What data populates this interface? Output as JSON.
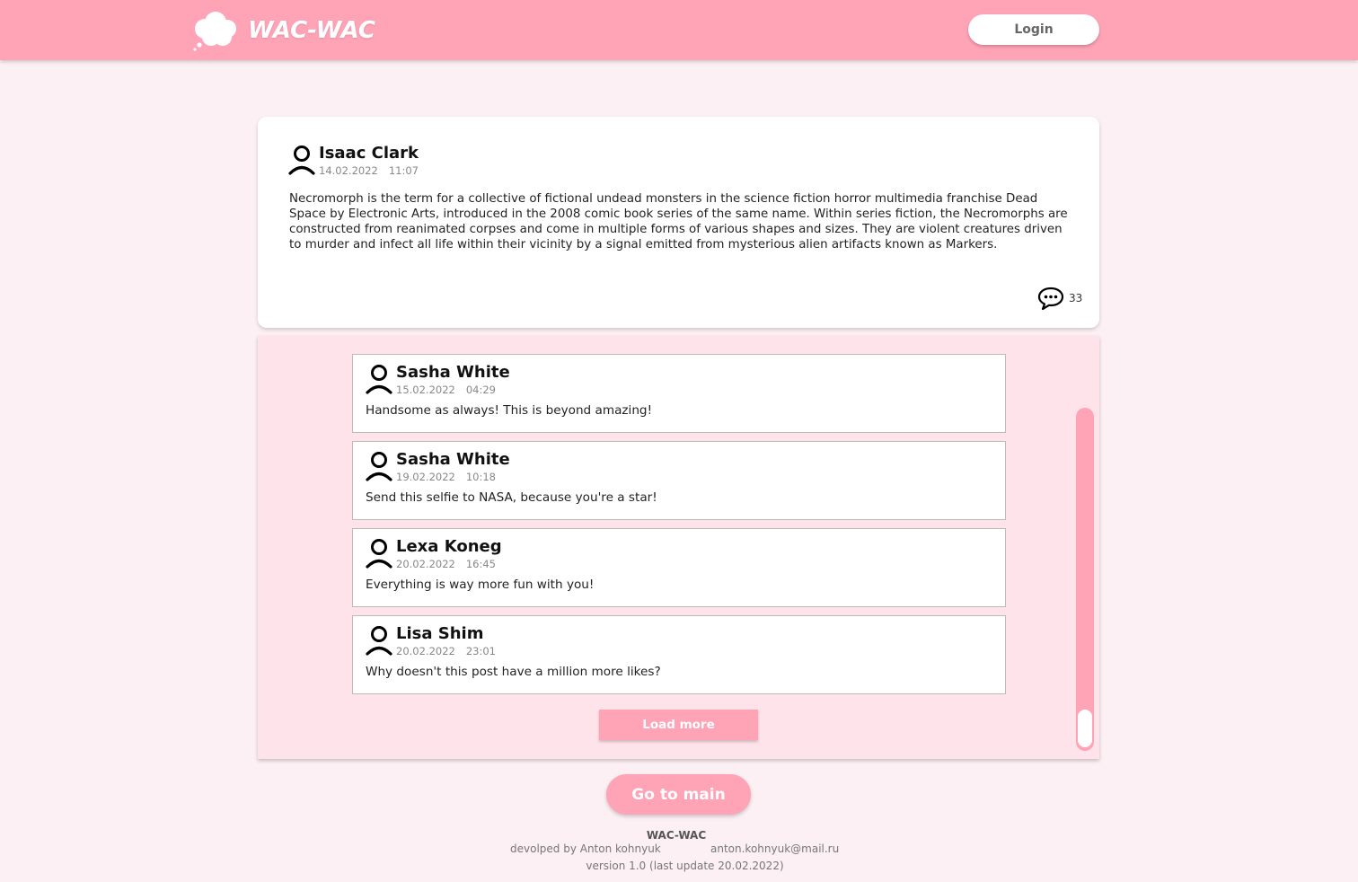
{
  "app": {
    "name": "WAC-WAC"
  },
  "header": {
    "login_label": "Login"
  },
  "post": {
    "author": "Isaac Clark",
    "date": "14.02.2022",
    "time": "11:07",
    "text": "Necromorph is the term for a collective of fictional undead monsters in the science fiction horror multimedia franchise Dead Space by Electronic Arts, introduced in the 2008 comic book series of the same name. Within series fiction, the Necromorphs are constructed from reanimated corpses and come in multiple forms of various shapes and sizes. They are violent creatures driven to murder and infect all life within their vicinity by a signal emitted from mysterious alien artifacts known as Markers.",
    "comment_count": "33",
    "comment_icon": "speech-bubble-icon",
    "author_icon": "user-icon"
  },
  "comments": [
    {
      "author": "Sasha White",
      "date": "15.02.2022",
      "time": "04:29",
      "text": "Handsome as always! This is beyond amazing!"
    },
    {
      "author": "Sasha White",
      "date": "19.02.2022",
      "time": "10:18",
      "text": "Send this selfie to NASA, because you're a star!"
    },
    {
      "author": "Lexa Koneg",
      "date": "20.02.2022",
      "time": "16:45",
      "text": "Everything is way more fun with you!"
    },
    {
      "author": "Lisa Shim",
      "date": "20.02.2022",
      "time": "23:01",
      "text": "Why doesn't this post have a million more likes?"
    }
  ],
  "comments_panel": {
    "load_more_label": "Load more"
  },
  "go_main_label": "Go to main",
  "footer": {
    "title": "WAC-WAC",
    "developer": "devolped by Anton kohnyuk",
    "email": "anton.kohnyuk@mail.ru",
    "version": "version 1.0 (last update 20.02.2022)"
  },
  "colors": {
    "accent": "#ffa3b7",
    "panel": "#ffe3ea",
    "background": "#fcf0f4"
  }
}
